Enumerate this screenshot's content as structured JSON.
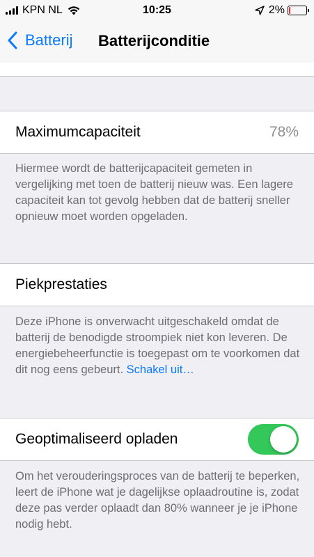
{
  "status_bar": {
    "carrier": "KPN NL",
    "time": "10:25",
    "battery_percent": "2%",
    "battery_level": 0.02,
    "icons": [
      "signal-icon",
      "wifi-icon",
      "location-arrow-icon",
      "battery-icon"
    ]
  },
  "nav": {
    "back_label": "Batterij",
    "title": "Batterijconditie"
  },
  "max_capacity": {
    "label": "Maximumcapaciteit",
    "value": "78%",
    "footer": "Hiermee wordt de batterijcapaciteit gemeten in vergelijking met toen de batterij nieuw was. Een lagere capaciteit kan tot gevolg hebben dat de batterij sneller opnieuw moet worden opgeladen."
  },
  "peak_performance": {
    "label": "Piekprestaties",
    "footer_text": "Deze iPhone is onverwacht uitgeschakeld omdat de batterij de benodigde stroompiek niet kon leveren. De energiebeheerfunctie is toegepast om te voorkomen dat dit nog eens gebeurt.",
    "footer_link": "Schakel uit…"
  },
  "optimized_charging": {
    "label": "Geoptimaliseerd opladen",
    "enabled": true,
    "footer": "Om het verouderingsproces van de batterij te beperken, leert de iPhone wat je dagelijkse oplaadroutine is, zodat deze pas verder oplaadt dan 80% wanneer je je iPhone nodig hebt."
  },
  "colors": {
    "accent": "#0a7aff",
    "toggle_on": "#34c759",
    "background": "#efeff4",
    "footer_text": "#6d6d72",
    "value_text": "#8e8e93",
    "battery_low": "#ee3333"
  }
}
